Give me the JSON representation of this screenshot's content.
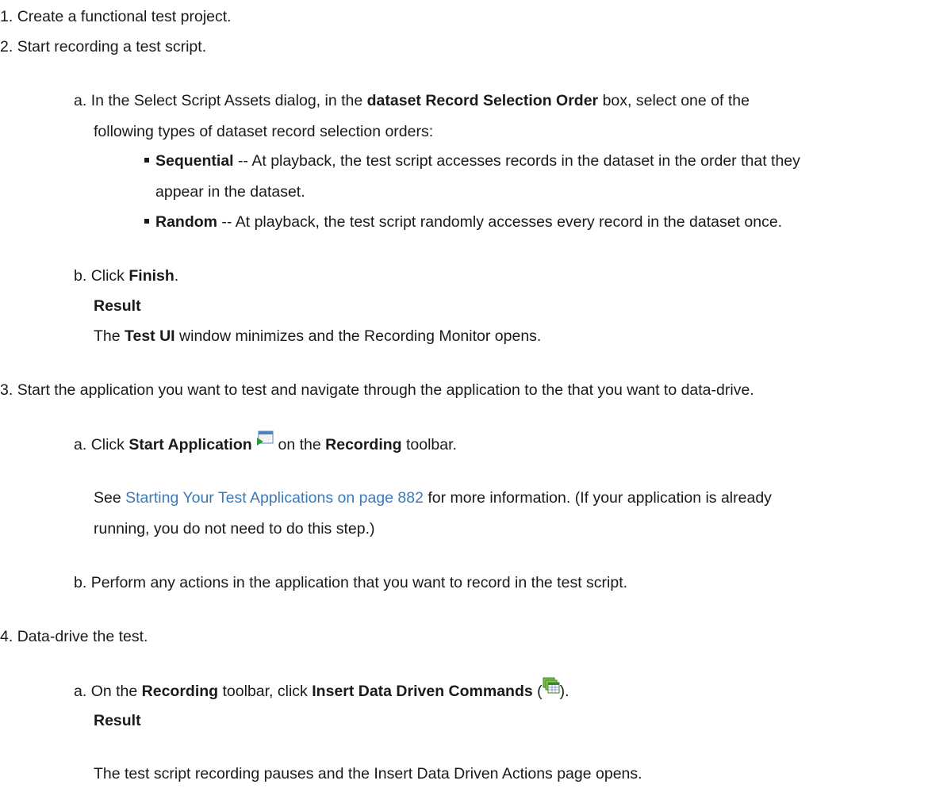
{
  "steps": [
    {
      "num": "1.",
      "text": "Create a functional test project."
    },
    {
      "num": "2.",
      "text": "Start recording a test script."
    },
    {
      "num": "3.",
      "text": "Start the application you want to test and navigate through the application to the that you want to data-drive."
    },
    {
      "num": "4.",
      "text": "Data-drive the test."
    }
  ],
  "step2": {
    "a": {
      "label": "a.",
      "t1": "In the Select Script Assets dialog, in the ",
      "b1": "dataset Record Selection Order",
      "t2": " box, select one of the",
      "line2": "following types of dataset record selection orders:",
      "bullets": [
        {
          "term": "Sequential",
          "text": " -- At playback, the test script accesses records in the dataset in the order that they",
          "cont": "appear in the dataset."
        },
        {
          "term": "Random",
          "text": " -- At playback, the test script randomly accesses every record in the dataset once."
        }
      ]
    },
    "b": {
      "label": "b.",
      "t1": "Click ",
      "b1": "Finish",
      "t2": ".",
      "result_label": "Result",
      "r1": "The ",
      "rb": "Test UI",
      "r2": " window minimizes and the Recording Monitor opens."
    }
  },
  "step3": {
    "a": {
      "label": "a.",
      "t1": "Click ",
      "b1": "Start Application",
      "t2": " on the ",
      "b2": "Recording",
      "t3": " toolbar.",
      "icon": "start-application-icon",
      "p1": "See ",
      "link": "Starting Your Test Applications on page 882",
      "p2": " for more information. (If your application is already",
      "p3": "running, you do not need to do this step.)"
    },
    "b": {
      "label": "b.",
      "text": "Perform any actions in the application that you want to record in the test script."
    }
  },
  "step4": {
    "a": {
      "label": "a.",
      "t1": "On the ",
      "b1": "Recording",
      "t2": " toolbar, click ",
      "b2": "Insert Data Driven Commands",
      "t3": " (",
      "icon": "insert-data-driven-commands-icon",
      "t4": ").",
      "result_label": "Result",
      "result": "The test script recording pauses and the Insert Data Driven Actions page opens."
    }
  },
  "colors": {
    "text": "#1a1a1a",
    "link": "#3d7ab8"
  }
}
